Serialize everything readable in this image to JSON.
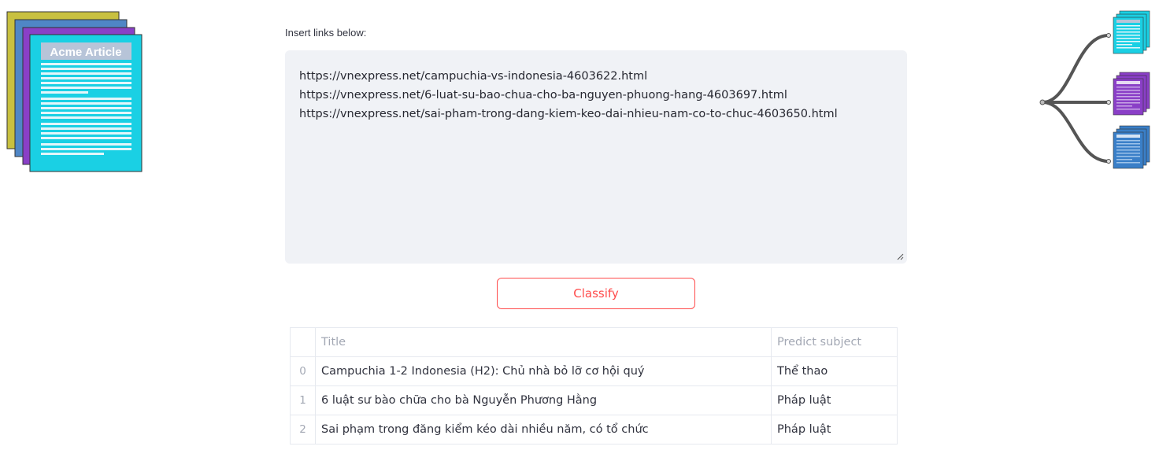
{
  "illustrations": {
    "left": {
      "icon": "article-stack-icon",
      "caption": "Acme Article",
      "colors": {
        "back": "#c8c040",
        "middle1": "#4f86c6",
        "middle2": "#8a3fc7",
        "front": "#1ad0e4"
      }
    },
    "right": {
      "icon": "article-tree-icon",
      "colors": {
        "top": "#1ad0e4",
        "middle": "#8a3fc7",
        "bottom": "#3a7fc8",
        "branch": "#555555"
      }
    }
  },
  "input": {
    "label": "Insert links below:",
    "value": "https://vnexpress.net/campuchia-vs-indonesia-4603622.html\nhttps://vnexpress.net/6-luat-su-bao-chua-cho-ba-nguyen-phuong-hang-4603697.html\nhttps://vnexpress.net/sai-pham-trong-dang-kiem-keo-dai-nhieu-nam-co-to-chuc-4603650.html"
  },
  "classify_button": {
    "label": "Classify",
    "color": "#ff4b4b"
  },
  "results": {
    "columns": {
      "index": "",
      "title": "Title",
      "subject": "Predict subject"
    },
    "rows": [
      {
        "index": "0",
        "title": "Campuchia 1-2 Indonesia (H2): Chủ nhà bỏ lỡ cơ hội quý",
        "subject": "Thể thao"
      },
      {
        "index": "1",
        "title": "6 luật sư bào chữa cho bà Nguyễn Phương Hằng",
        "subject": "Pháp luật"
      },
      {
        "index": "2",
        "title": "Sai phạm trong đăng kiểm kéo dài nhiều năm, có tổ chức",
        "subject": "Pháp luật"
      }
    ]
  }
}
